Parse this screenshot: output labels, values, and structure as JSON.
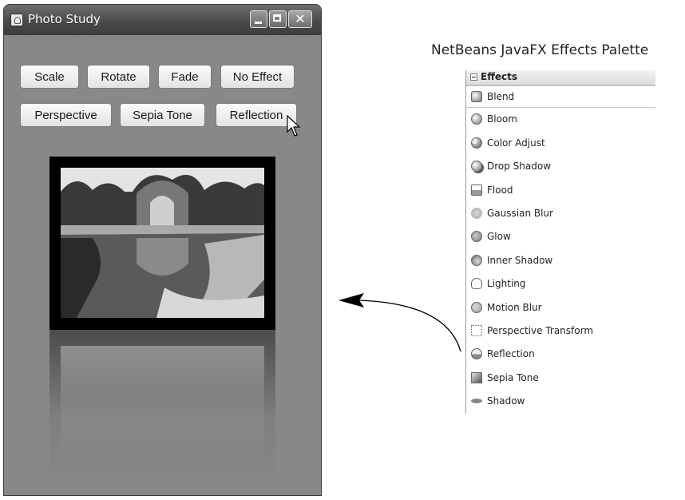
{
  "window": {
    "title": "Photo Study",
    "controls": {
      "minimize": "",
      "maximize": "",
      "close": "✕"
    },
    "buttons_row1": [
      "Scale",
      "Rotate",
      "Fade",
      "No Effect"
    ],
    "buttons_row2": [
      "Perspective",
      "Sepia Tone",
      "Reflection"
    ]
  },
  "palette": {
    "title": "NetBeans JavaFX Effects Palette",
    "header": "Effects",
    "items": [
      {
        "label": "Blend",
        "icon": "blend-icon"
      },
      {
        "label": "Bloom",
        "icon": "bloom-icon"
      },
      {
        "label": "Color Adjust",
        "icon": "color-adjust-icon"
      },
      {
        "label": "Drop Shadow",
        "icon": "drop-shadow-icon"
      },
      {
        "label": "Flood",
        "icon": "flood-icon"
      },
      {
        "label": "Gaussian Blur",
        "icon": "gaussian-blur-icon"
      },
      {
        "label": "Glow",
        "icon": "glow-icon"
      },
      {
        "label": "Inner Shadow",
        "icon": "inner-shadow-icon"
      },
      {
        "label": "Lighting",
        "icon": "lighting-icon"
      },
      {
        "label": "Motion Blur",
        "icon": "motion-blur-icon"
      },
      {
        "label": "Perspective Transform",
        "icon": "perspective-transform-icon"
      },
      {
        "label": "Reflection",
        "icon": "reflection-icon"
      },
      {
        "label": "Sepia Tone",
        "icon": "sepia-tone-icon"
      },
      {
        "label": "Shadow",
        "icon": "shadow-icon"
      }
    ]
  }
}
